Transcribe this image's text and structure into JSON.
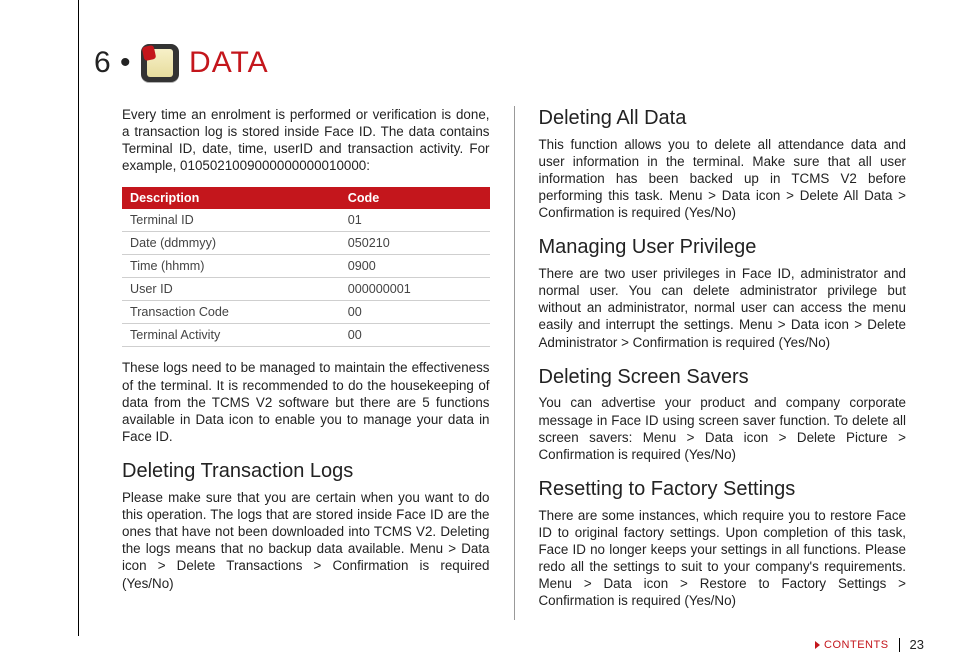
{
  "chapter": {
    "num": "6 •",
    "title": "DATA"
  },
  "left": {
    "intro": "Every time an enrolment is performed or verification is done, a transaction log is stored inside Face ID. The data contains Terminal ID, date, time, userID and transaction activity. For example, 0105021009000000000010000:",
    "table": {
      "headers": [
        "Description",
        "Code"
      ],
      "rows": [
        [
          "Terminal ID",
          "01"
        ],
        [
          "Date (ddmmyy)",
          "050210"
        ],
        [
          "Time (hhmm)",
          "0900"
        ],
        [
          "User ID",
          "000000001"
        ],
        [
          "Transaction Code",
          "00"
        ],
        [
          "Terminal Activity",
          "00"
        ]
      ]
    },
    "afterTable": "These logs need to be managed to maintain the effectiveness of the terminal. It is recommended to do the housekeeping of data from the TCMS V2 software but there are 5 functions available in Data icon to enable you to manage your data in Face ID.",
    "h1": "Deleting Transaction Logs",
    "p1": "Please make sure that you are certain when you want to do this operation. The logs that are stored inside Face ID are the ones that have not been downloaded into TCMS V2. Deleting the logs means that no backup data available. Menu > Data icon > Delete Transactions > Confirmation is required (Yes/No)"
  },
  "right": {
    "h1": "Deleting All Data",
    "p1": "This function allows you to delete all attendance data and user information in the terminal. Make sure that all user information has been backed up in TCMS V2 before performing this task. Menu > Data icon > Delete All Data > Confirmation is required (Yes/No)",
    "h2": "Managing User Privilege",
    "p2": "There are two user privileges in Face ID, administrator and normal user. You can delete administrator privilege but without an administrator, normal user  can access the menu easily and interrupt the settings. Menu > Data icon > Delete Administrator > Confirmation is required (Yes/No)",
    "h3": "Deleting Screen Savers",
    "p3": "You can advertise your product and company corporate message in Face ID using screen saver function. To delete all screen savers: Menu > Data icon > Delete Picture > Confirmation is required (Yes/No)",
    "h4": "Resetting to Factory Settings",
    "p4": "There are some instances, which require you to restore Face ID to original factory settings. Upon completion of this task, Face ID no longer keeps your settings in all functions. Please redo all the settings to suit to your company's requirements. Menu > Data icon > Restore to Factory Settings > Confirmation is required (Yes/No)"
  },
  "footer": {
    "contents": "CONTENTS",
    "page": "23"
  }
}
